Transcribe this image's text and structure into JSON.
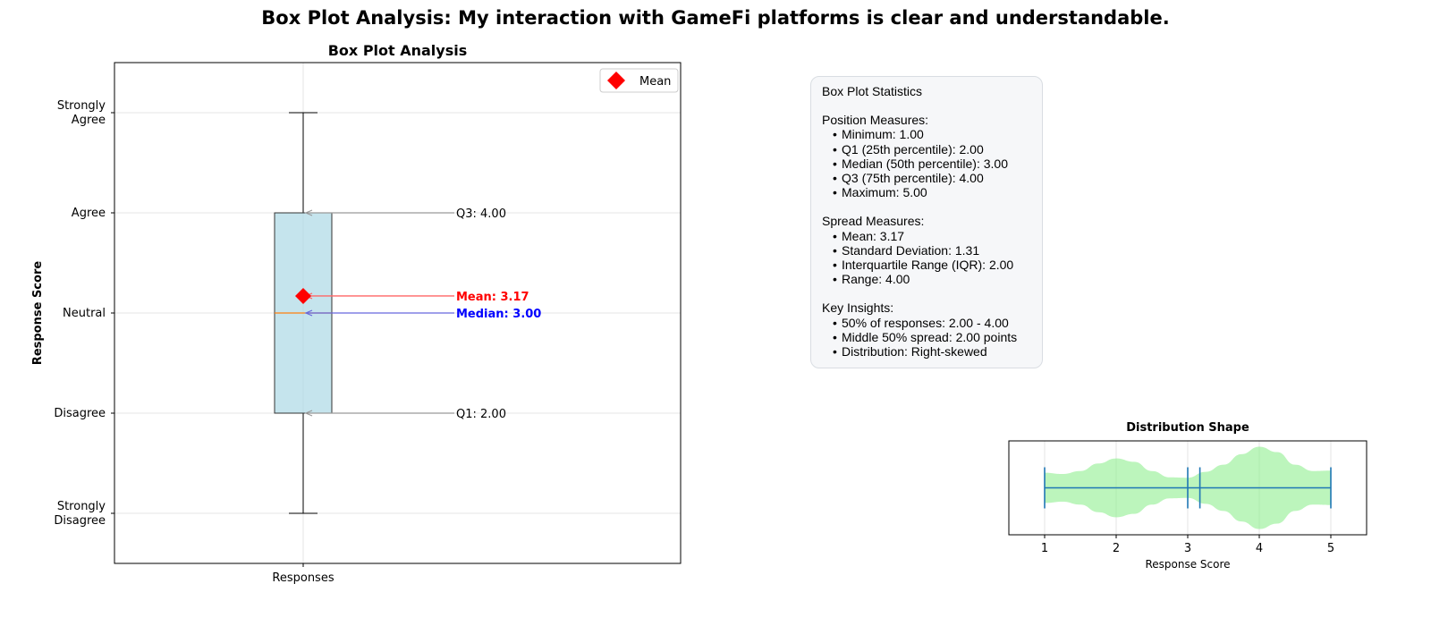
{
  "suptitle": "Box Plot Analysis: My interaction with GameFi platforms is clear and understandable.",
  "chart_data": [
    {
      "type": "box",
      "title": "Box Plot Analysis",
      "xlabel": "",
      "ylabel": "Response Score",
      "categories": [
        "Responses"
      ],
      "ylim": [
        0.5,
        5.5
      ],
      "yticks": [
        1,
        2,
        3,
        4,
        5
      ],
      "ytick_labels": [
        "Strongly\nDisagree",
        "Disagree",
        "Neutral",
        "Agree",
        "Strongly\nAgree"
      ],
      "grid": true,
      "legend": {
        "position": "top-right",
        "entries": [
          "Mean"
        ]
      },
      "box": {
        "min": 1,
        "q1": 2,
        "median": 3,
        "q3": 4,
        "max": 5,
        "mean": 3.17
      },
      "annotations": [
        {
          "label": "Q3: 4.00",
          "target": 4.0,
          "color": "#000000"
        },
        {
          "label": "Mean: 3.17",
          "target": 3.17,
          "color": "#ff0000",
          "bold": true
        },
        {
          "label": "Median: 3.00",
          "target": 3.0,
          "color": "#0000ff",
          "bold": true
        },
        {
          "label": "Q1: 2.00",
          "target": 2.0,
          "color": "#000000"
        }
      ],
      "colors": {
        "box_fill": "#add8e6",
        "median": "#ff7f0e",
        "mean": "#ff0000"
      }
    },
    {
      "type": "violin",
      "title": "Distribution Shape",
      "xlabel": "Response Score",
      "xlim": [
        0.5,
        5.5
      ],
      "xticks": [
        1,
        2,
        3,
        4,
        5
      ],
      "min": 1,
      "max": 5,
      "mean": 3.17,
      "median": 3,
      "density": [
        [
          1.0,
          0.36
        ],
        [
          1.25,
          0.33
        ],
        [
          1.5,
          0.4
        ],
        [
          1.75,
          0.58
        ],
        [
          2.0,
          0.7
        ],
        [
          2.25,
          0.62
        ],
        [
          2.5,
          0.4
        ],
        [
          2.75,
          0.25
        ],
        [
          3.0,
          0.24
        ],
        [
          3.25,
          0.38
        ],
        [
          3.5,
          0.55
        ],
        [
          3.75,
          0.8
        ],
        [
          4.0,
          0.98
        ],
        [
          4.25,
          0.85
        ],
        [
          4.5,
          0.55
        ],
        [
          4.75,
          0.4
        ],
        [
          5.0,
          0.41
        ]
      ],
      "colors": {
        "fill": "#90ee90",
        "lines": "#1f77b4"
      }
    }
  ],
  "stats_panel": {
    "title": "Box Plot Statistics",
    "position_heading": "Position Measures:",
    "position_items": [
      "Minimum: 1.00",
      "Q1 (25th percentile): 2.00",
      "Median (50th percentile): 3.00",
      "Q3 (75th percentile): 4.00",
      "Maximum: 5.00"
    ],
    "spread_heading": "Spread Measures:",
    "spread_items": [
      "Mean: 3.17",
      "Standard Deviation: 1.31",
      "Interquartile Range (IQR): 2.00",
      "Range: 4.00"
    ],
    "insights_heading": "Key Insights:",
    "insights_items": [
      "50% of responses: 2.00 - 4.00",
      "Middle 50% spread: 2.00 points",
      "Distribution: Right-skewed"
    ]
  }
}
